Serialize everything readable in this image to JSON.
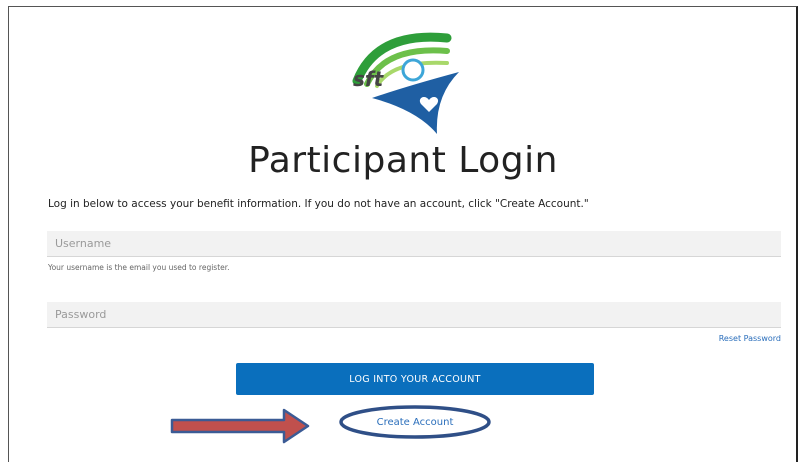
{
  "header": {
    "title": "Participant Login"
  },
  "intro_text": "Log in below to access your benefit information. If you do not have an account, click \"Create Account.\"",
  "form": {
    "username_placeholder": "Username",
    "username_hint": "Your username is the email you used to register.",
    "password_placeholder": "Password",
    "reset_password_label": "Reset Password",
    "login_button_label": "LOG INTO YOUR ACCOUNT",
    "create_account_label": "Create Account"
  },
  "logo": {
    "text": "sft",
    "colors": {
      "arc_green": "#2e9e3a",
      "arc_light": "#8ccf5a",
      "figure_blue": "#1f5fa3",
      "head_sky": "#3da6d8"
    }
  },
  "annotations": {
    "arrow_icon": "right-arrow-icon",
    "highlight": "ellipse-highlight"
  },
  "colors": {
    "primary_button": "#0a6fbd",
    "link": "#2a6ebb",
    "arrow_fill": "#c0504d",
    "arrow_outline": "#3b5b95",
    "ellipse_outline": "#2f4f87"
  }
}
